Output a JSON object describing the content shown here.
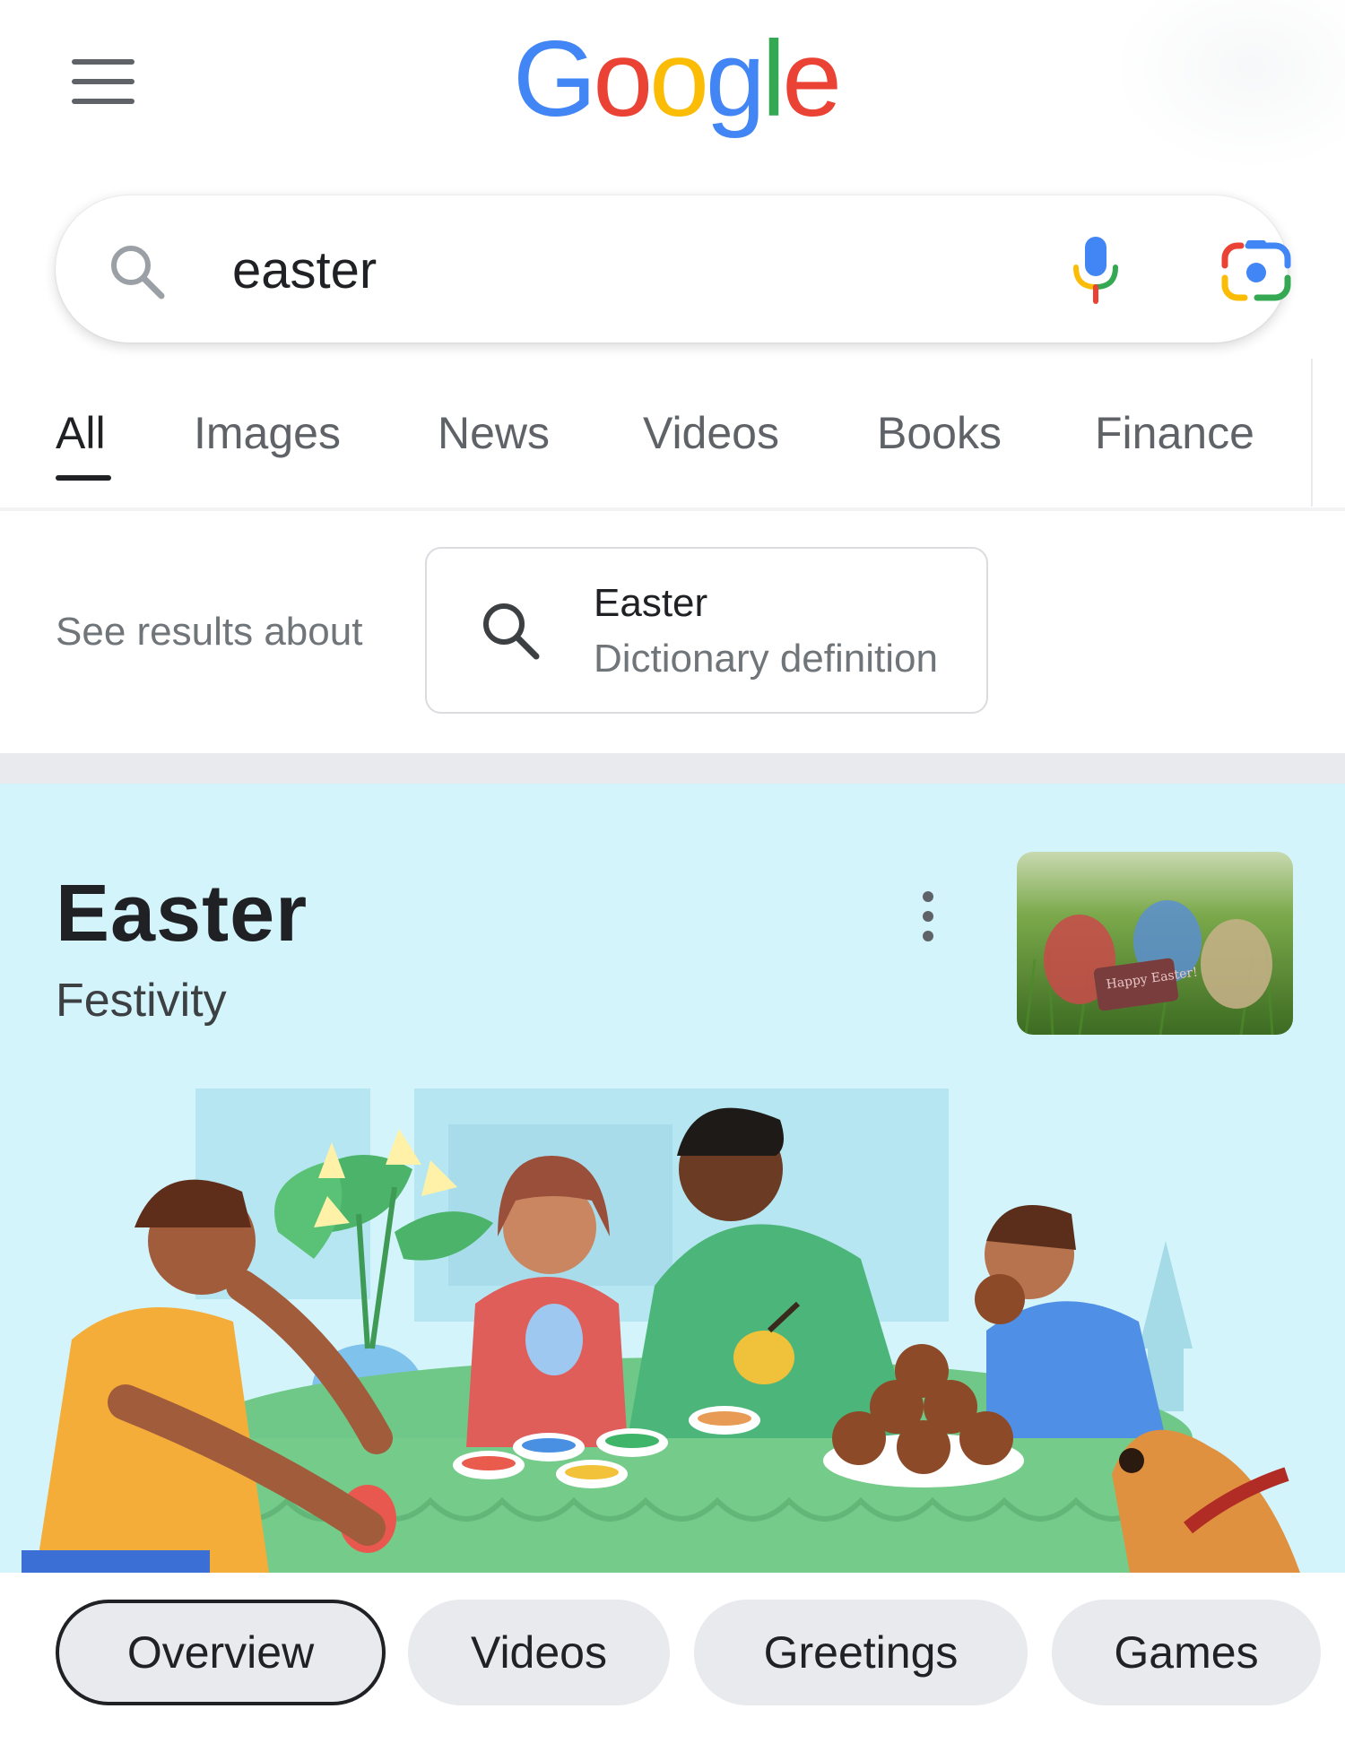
{
  "header": {
    "logo": [
      "G",
      "o",
      "o",
      "g",
      "l",
      "e"
    ],
    "logo_colors": [
      "#4285F4",
      "#EA4335",
      "#FBBC05",
      "#4285F4",
      "#34A853",
      "#EA4335"
    ]
  },
  "search": {
    "query": "easter"
  },
  "tabs": [
    {
      "label": "All",
      "active": true
    },
    {
      "label": "Images"
    },
    {
      "label": "News"
    },
    {
      "label": "Videos"
    },
    {
      "label": "Books"
    },
    {
      "label": "Finance"
    }
  ],
  "see_results": {
    "label": "See results about",
    "chip_title": "Easter",
    "chip_subtitle": "Dictionary definition"
  },
  "knowledge_panel": {
    "title": "Easter",
    "subtitle": "Festivity",
    "background": "#d4f4fb",
    "thumbnail_text": "Happy Easter!"
  },
  "chips": [
    {
      "label": "Overview",
      "active": true
    },
    {
      "label": "Videos"
    },
    {
      "label": "Greetings"
    },
    {
      "label": "Games"
    }
  ]
}
